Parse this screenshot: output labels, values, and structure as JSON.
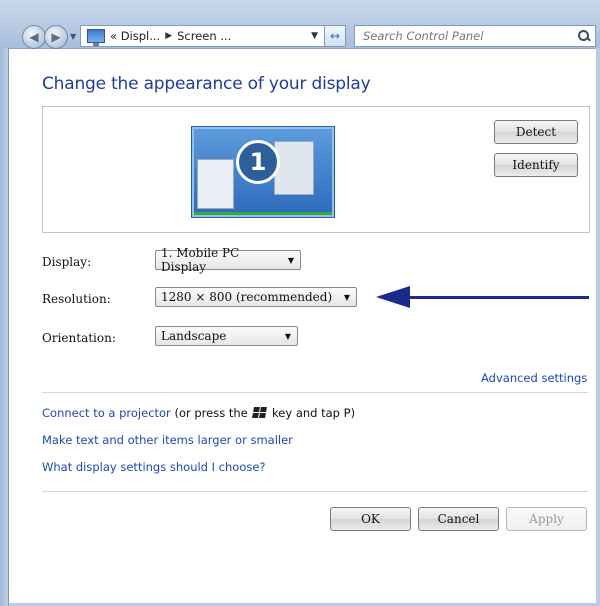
{
  "window": {
    "breadcrumb": [
      "« Displ...",
      "Screen ..."
    ],
    "search_placeholder": "Search Control Panel"
  },
  "page": {
    "title": "Change the appearance of your display"
  },
  "preview": {
    "monitor_number": "1",
    "detect_label": "Detect",
    "identify_label": "Identify"
  },
  "settings": {
    "display_label": "Display:",
    "display_value": "1. Mobile PC Display",
    "resolution_label": "Resolution:",
    "resolution_value": "1280 × 800 (recommended)",
    "orientation_label": "Orientation:",
    "orientation_value": "Landscape",
    "advanced_link": "Advanced settings"
  },
  "links": {
    "projector_link": "Connect to a projector",
    "projector_text_before": " (or press the ",
    "projector_text_after": " key and tap P)",
    "larger_text_link": "Make text and other items larger or smaller",
    "which_settings_link": "What display settings should I choose?"
  },
  "footer": {
    "ok_label": "OK",
    "cancel_label": "Cancel",
    "apply_label": "Apply"
  },
  "colors": {
    "title": "#1e3c9a",
    "link": "#1e47b8",
    "annotation_arrow": "#1c2a8c"
  },
  "icons": [
    "back-arrow-icon",
    "forward-arrow-icon",
    "display-icon",
    "refresh-icon",
    "search-icon",
    "windows-key-icon",
    "monitor-icon"
  ]
}
